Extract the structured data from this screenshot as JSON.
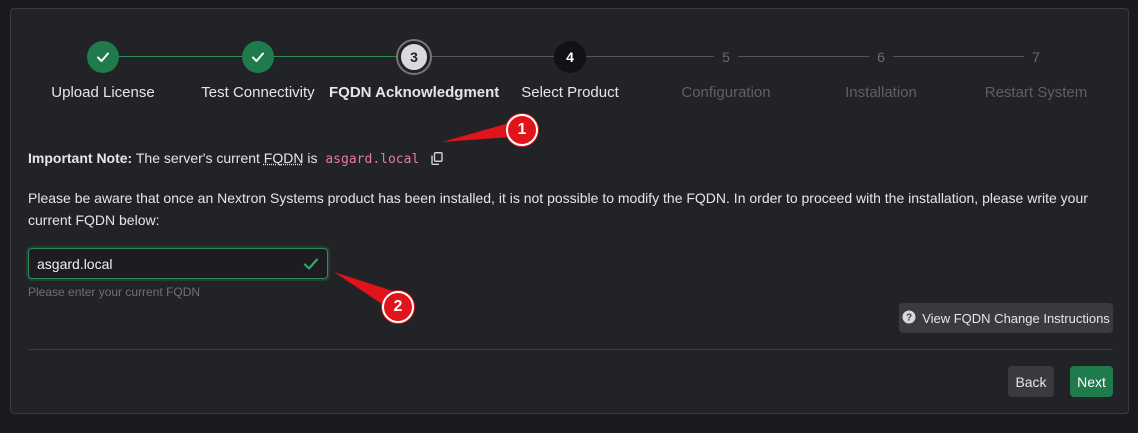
{
  "steps": [
    {
      "number": "1",
      "label": "Upload License",
      "state": "done"
    },
    {
      "number": "2",
      "label": "Test Connectivity",
      "state": "done"
    },
    {
      "number": "3",
      "label": "FQDN Acknowledgment",
      "state": "active"
    },
    {
      "number": "4",
      "label": "Select Product",
      "state": "next"
    },
    {
      "number": "5",
      "label": "Configuration",
      "state": "pending"
    },
    {
      "number": "6",
      "label": "Installation",
      "state": "pending"
    },
    {
      "number": "7",
      "label": "Restart System",
      "state": "pending"
    }
  ],
  "note": {
    "prefix": "Important Note:",
    "text_before": " The server's current ",
    "fqdn_abbr": "FQDN",
    "text_after": " is ",
    "fqdn_value": "asgard.local"
  },
  "paragraph": "Please be aware that once an Nextron Systems product has been installed, it is not possible to modify the FQDN. In order to proceed with the installation, please write your current FQDN below:",
  "fqdn_input": {
    "value": "asgard.local",
    "hint": "Please enter your current FQDN"
  },
  "buttons": {
    "view_instructions": "View FQDN Change Instructions",
    "back": "Back",
    "next": "Next"
  },
  "annotations": {
    "badge1": "1",
    "badge2": "2"
  },
  "colors": {
    "success": "#1f7a4c",
    "accent_code": "#e67aa5",
    "annotation_red": "#e0141a"
  },
  "icons": {
    "copy": "copy-icon",
    "check": "check-icon",
    "help": "question-circle-icon"
  }
}
